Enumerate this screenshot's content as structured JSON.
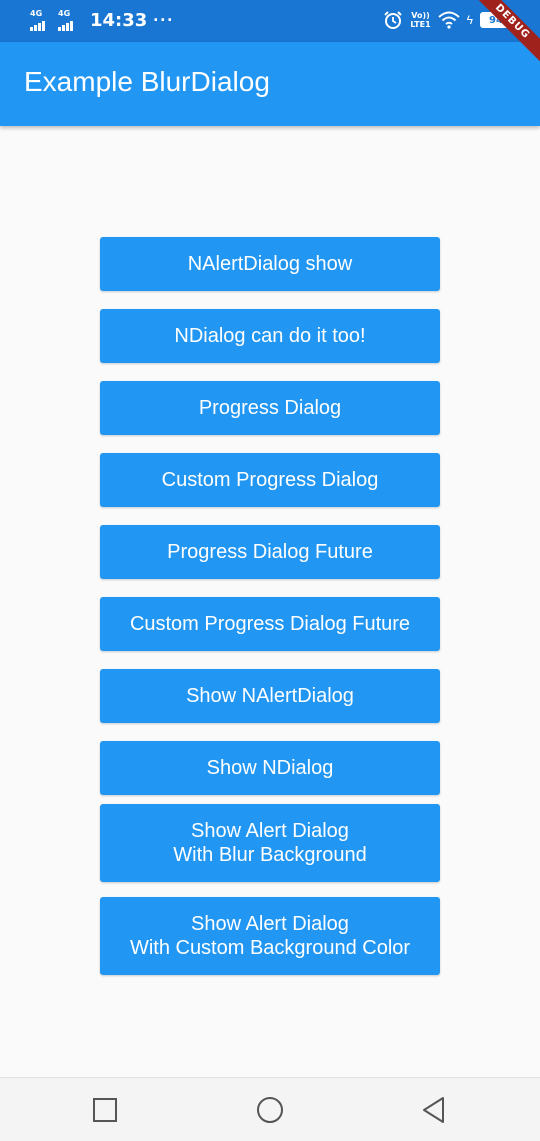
{
  "status_bar": {
    "network_1": "4G",
    "network_2": "4G",
    "time": "14:33",
    "more": "···",
    "volte_top": "Vo))",
    "volte_bottom": "LTE1",
    "charging": "ϟ",
    "battery": "94"
  },
  "debug_banner": "DEBUG",
  "app_bar": {
    "title": "Example BlurDialog"
  },
  "buttons": [
    {
      "label": "NAlertDialog show"
    },
    {
      "label": "NDialog can do it too!"
    },
    {
      "label": "Progress Dialog"
    },
    {
      "label": "Custom Progress Dialog"
    },
    {
      "label": "Progress Dialog Future"
    },
    {
      "label": "Custom Progress Dialog Future"
    },
    {
      "label": "Show NAlertDialog"
    },
    {
      "label": "Show NDialog"
    },
    {
      "label": "Show Alert Dialog\nWith Blur Background"
    },
    {
      "label": "Show Alert Dialog\nWith Custom Background Color"
    }
  ],
  "nav_bar": {
    "icons": [
      "recents-square-icon",
      "home-circle-icon",
      "back-triangle-icon"
    ]
  },
  "colors": {
    "status_bar": "#1976d2",
    "app_bar": "#2196f3",
    "button": "#2196f3",
    "background": "#fafafa"
  }
}
